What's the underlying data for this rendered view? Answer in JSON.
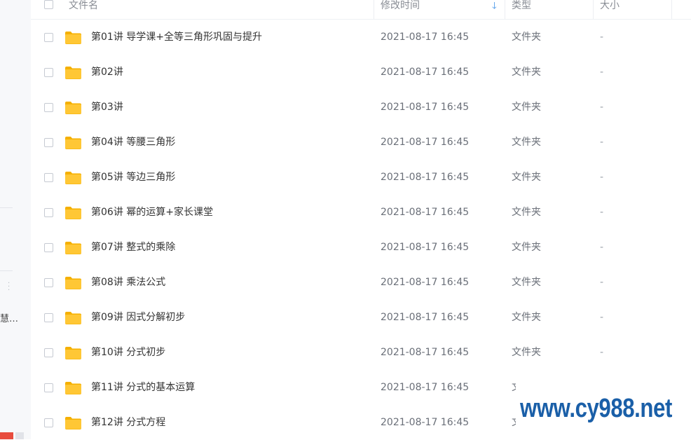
{
  "sidebar": {
    "truncated_label": "慧…"
  },
  "header": {
    "col_name": "文件名",
    "col_modified": "修改时间",
    "col_type": "类型",
    "col_size": "大小",
    "sort_icon": "arrow-down-icon"
  },
  "files": [
    {
      "name": "第01讲 导学课+全等三角形巩固与提升",
      "modified": "2021-08-17 16:45",
      "type": "文件夹",
      "size": "-"
    },
    {
      "name": "第02讲",
      "modified": "2021-08-17 16:45",
      "type": "文件夹",
      "size": "-"
    },
    {
      "name": "第03讲",
      "modified": "2021-08-17 16:45",
      "type": "文件夹",
      "size": "-"
    },
    {
      "name": "第04讲 等腰三角形",
      "modified": "2021-08-17 16:45",
      "type": "文件夹",
      "size": "-"
    },
    {
      "name": "第05讲 等边三角形",
      "modified": "2021-08-17 16:45",
      "type": "文件夹",
      "size": "-"
    },
    {
      "name": "第06讲 幂的运算+家长课堂",
      "modified": "2021-08-17 16:45",
      "type": "文件夹",
      "size": "-"
    },
    {
      "name": "第07讲 整式的乘除",
      "modified": "2021-08-17 16:45",
      "type": "文件夹",
      "size": "-"
    },
    {
      "name": "第08讲 乘法公式",
      "modified": "2021-08-17 16:45",
      "type": "文件夹",
      "size": "-"
    },
    {
      "name": "第09讲 因式分解初步",
      "modified": "2021-08-17 16:45",
      "type": "文件夹",
      "size": "-"
    },
    {
      "name": "第10讲 分式初步",
      "modified": "2021-08-17 16:45",
      "type": "文件夹",
      "size": "-"
    },
    {
      "name": "第11讲 分式的基本运算",
      "modified": "2021-08-17 16:45",
      "type": "文件夹",
      "size": "-"
    },
    {
      "name": "第12讲 分式方程",
      "modified": "2021-08-17 16:45",
      "type": "文件夹",
      "size": "-"
    }
  ],
  "watermark": "www.cy988.net",
  "colors": {
    "folder": "#ffc735",
    "folder_back": "#f5b000",
    "accent": "#3a8ee6",
    "watermark": "#1a5fa8"
  }
}
